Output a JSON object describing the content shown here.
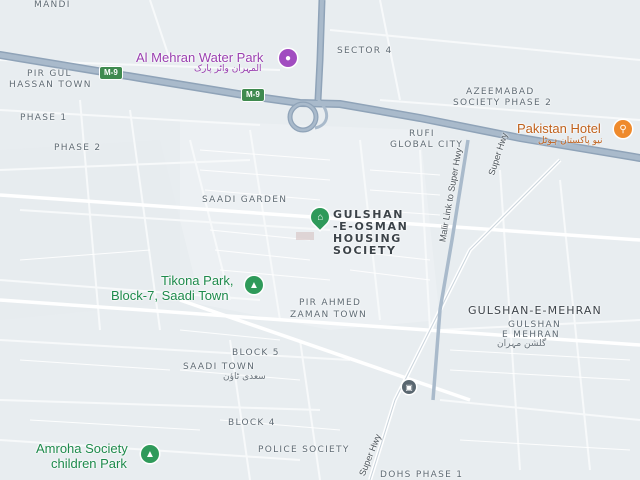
{
  "map": {
    "area_labels": {
      "mandi": "MANDI",
      "sector4": "SECTOR 4",
      "pir_gul_1": "PIR GUL",
      "pir_gul_2": "HASSAN TOWN",
      "phase1": "PHASE 1",
      "phase2": "PHASE 2",
      "azeemabad_1": "AZEEMABAD",
      "azeemabad_2": "SOCIETY PHASE 2",
      "rufi_1": "RUFI",
      "rufi_2": "GLOBAL CITY",
      "saadi_garden": "SAADI GARDEN",
      "pir_ahmed_1": "PIR AHMED",
      "pir_ahmed_2": "ZAMAN TOWN",
      "gulshan_mehran": "GULSHAN-E-MEHRAN",
      "gulshan_mehran_sub1": "GULSHAN",
      "gulshan_mehran_sub2": "E MEHRAN",
      "block5": "BLOCK 5",
      "saadi_town": "SAADI TOWN",
      "block4": "BLOCK 4",
      "police_society": "POLICE SOCIETY",
      "dohs": "DOHS PHASE 1"
    },
    "selected_place": {
      "line1": "GULSHAN",
      "line2": "-E-OSMAN",
      "line3": "HOUSING",
      "line4": "SOCIETY"
    },
    "urdu_labels": {
      "water_park": "المہران واٹر پارک",
      "hotel": "نیو پاکستان ہوٹل",
      "saadi_town": "سعدی ٹاؤن",
      "gulshan_mehran": "گلشن مہران"
    },
    "pois": {
      "water_park": "Al Mehran Water Park",
      "hotel": "Pakistan Hotel",
      "tikona_1": "Tikona Park,",
      "tikona_2": "Block-7, Saadi Town",
      "amroha_1": "Amroha Society",
      "amroha_2": "children Park"
    },
    "roads": {
      "m9_a": "M-9",
      "m9_b": "M-9",
      "malir_link": "Malir Link to Super Hwy",
      "super_hwy_n": "Super Hwy",
      "super_hwy_s": "Super Hwy"
    },
    "icons": {
      "park": "tree-icon",
      "water_park": "water-park-icon",
      "hotel": "hotel-icon",
      "selected": "location-pin-icon",
      "transit": "bus-station-icon"
    },
    "colors": {
      "background": "#e8edf0",
      "motorway": "#8fa3b8",
      "park_green": "#1e8a4c",
      "pin_green": "#2f9a5a",
      "water_park_purple": "#9a3fb0",
      "hotel_orange": "#c0611c"
    }
  }
}
